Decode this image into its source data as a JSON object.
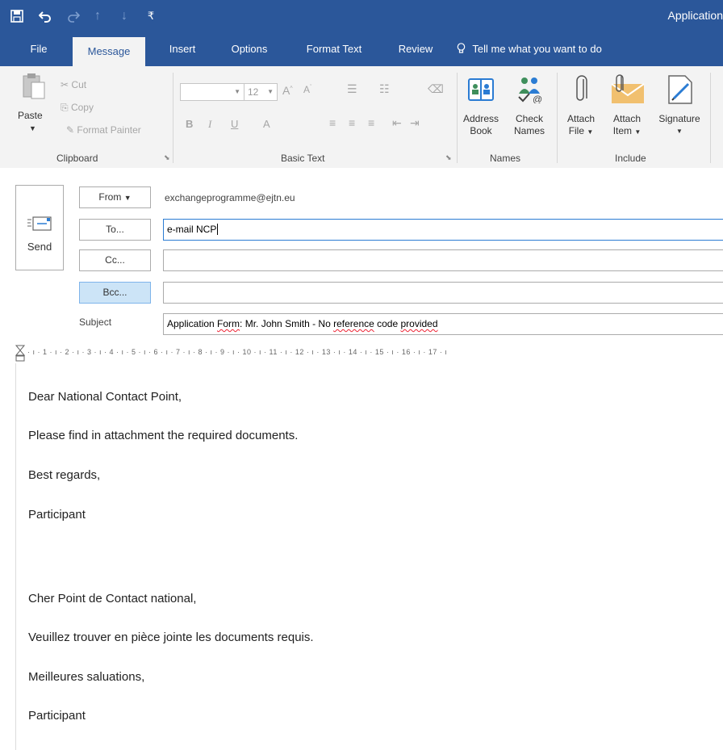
{
  "window": {
    "title": "Application"
  },
  "quick_access": {
    "save_icon": "save-icon",
    "undo_icon": "undo-icon",
    "redo_icon": "redo-icon",
    "up_icon": "arrow-up-icon",
    "down_icon": "arrow-down-icon",
    "customize_icon": "customize-icon"
  },
  "tabs": [
    {
      "label": "File"
    },
    {
      "label": "Message"
    },
    {
      "label": "Insert"
    },
    {
      "label": "Options"
    },
    {
      "label": "Format Text"
    },
    {
      "label": "Review"
    }
  ],
  "tell_me": "Tell me what you want to do",
  "ribbon": {
    "clipboard": {
      "paste": "Paste",
      "cut": "Cut",
      "copy": "Copy",
      "format_painter": "Format Painter",
      "group_label": "Clipboard"
    },
    "basic_text": {
      "font_name": "",
      "font_size": "12",
      "bold": "B",
      "italic": "I",
      "underline": "U",
      "font_color": "A",
      "group_label": "Basic Text"
    },
    "names": {
      "address_book_line1": "Address",
      "address_book_line2": "Book",
      "check_names_line1": "Check",
      "check_names_line2": "Names",
      "group_label": "Names"
    },
    "include": {
      "attach_file_line1": "Attach",
      "attach_file_line2": "File",
      "attach_item_line1": "Attach",
      "attach_item_line2": "Item",
      "signature": "Signature",
      "group_label": "Include"
    }
  },
  "compose": {
    "send": "Send",
    "from_button": "From",
    "from_address": "exchangeprogramme@ejtn.eu",
    "to_button": "To...",
    "to_value": "e-mail NCP",
    "cc_button": "Cc...",
    "cc_value": "",
    "bcc_button": "Bcc...",
    "bcc_value": "",
    "subject_label": "Subject",
    "subject_part1": "Application ",
    "subject_part2": "Form",
    "subject_part3": ": Mr. John Smith - No ",
    "subject_part4": "reference",
    "subject_part5": " code ",
    "subject_part6": "provided"
  },
  "ruler_marks": "· ı · 1 · ı · 2 · ı · 3 · ı · 4 · ı · 5 · ı · 6 · ı · 7 · ı · 8 · ı · 9 · ı · 10 · ı · 11 · ı · 12 · ı · 13 · ı · 14 · ı · 15 · ı · 16 · ı · 17 · ı",
  "body_lines": [
    "Dear National Contact Point,",
    "Please find in attachment the required documents.",
    "Best regards,",
    "Participant",
    "Cher Point de Contact national,",
    "Veuillez trouver en pièce jointe les documents requis.",
    "Meilleures saluations,",
    "Participant"
  ],
  "colors": {
    "accent": "#2b579a",
    "ribbon_bg": "#f3f3f3",
    "selected_button": "#cce4f7"
  }
}
